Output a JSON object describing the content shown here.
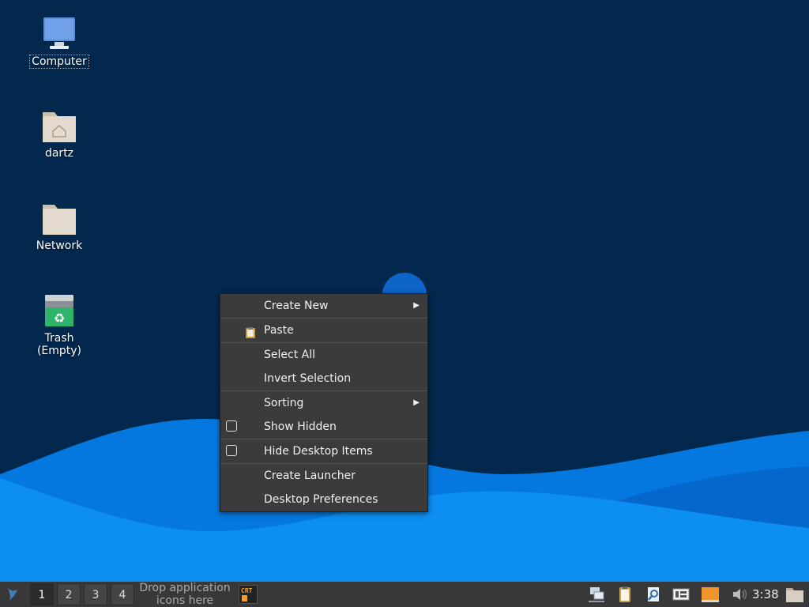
{
  "desktop": {
    "icons": [
      {
        "label": "Computer"
      },
      {
        "label": "dartz"
      },
      {
        "label": "Network"
      },
      {
        "label": "Trash (Empty)"
      }
    ]
  },
  "context_menu": {
    "items": [
      {
        "label": "Create New",
        "submenu": true
      },
      {
        "label": "Paste",
        "icon": "clipboard-icon"
      },
      {
        "label": "Select All"
      },
      {
        "label": "Invert Selection"
      },
      {
        "label": "Sorting",
        "submenu": true
      },
      {
        "label": "Show Hidden",
        "checkbox": true,
        "checked": false
      },
      {
        "label": "Hide Desktop Items",
        "checkbox": true,
        "checked": false
      },
      {
        "label": "Create Launcher"
      },
      {
        "label": "Desktop Preferences"
      }
    ]
  },
  "panel": {
    "workspaces": [
      "1",
      "2",
      "3",
      "4"
    ],
    "active_workspace": "1",
    "launcher_drop_line1": "Drop application",
    "launcher_drop_line2": "icons here",
    "crt_label": "CRT",
    "clock": "3:38",
    "tray_icons": [
      "network-icon",
      "clipboard-icon",
      "search-icon",
      "keyboard-layout-icon",
      "battery-icon",
      "volume-icon",
      "folder-icon"
    ]
  },
  "colors": {
    "desktop_bg": "#02284e",
    "wave_light": "#0a8cf0",
    "wave_mid": "#0470d8",
    "menu_bg": "#3b3b3b",
    "panel_bg": "#383838"
  }
}
